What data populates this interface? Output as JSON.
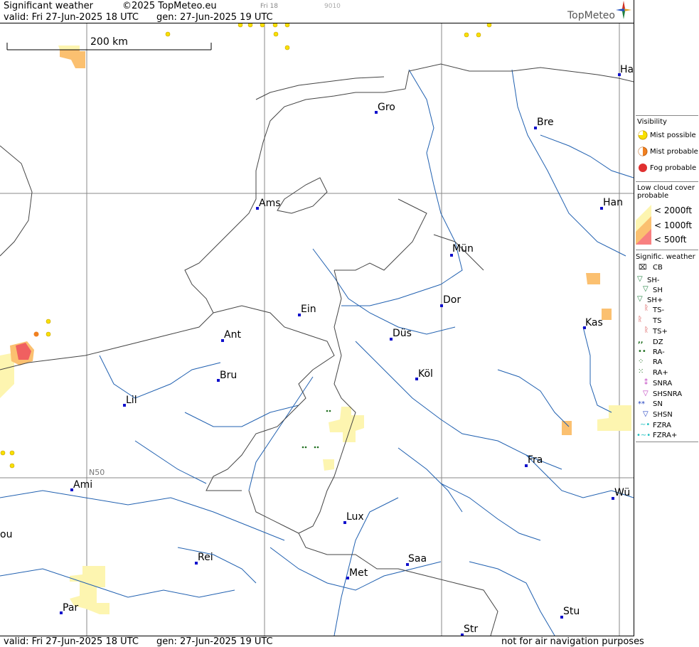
{
  "header": {
    "title": "Significant weather",
    "copyright": "©2025 TopMeteo.eu",
    "run_small": "Fri 18",
    "code_small": "9010",
    "valid": "valid:  Fri  27-Jun-2025  18 UTC",
    "gen": "gen: 27-Jun-2025 19 UTC",
    "logo": "TopMeteo"
  },
  "footer": {
    "valid": "valid:  Fri  27-Jun-2025  18 UTC",
    "gen": "gen: 27-Jun-2025 19 UTC",
    "disclaimer": "not for air navigation purposes"
  },
  "map": {
    "scale_label": "200 km",
    "lat_label": "N50",
    "cities": [
      {
        "name": "Gro"
      },
      {
        "name": "Bre"
      },
      {
        "name": "Ha"
      },
      {
        "name": "Ams"
      },
      {
        "name": "Han"
      },
      {
        "name": "Mün"
      },
      {
        "name": "Dor"
      },
      {
        "name": "Ein"
      },
      {
        "name": "Ant"
      },
      {
        "name": "Düs"
      },
      {
        "name": "Kas"
      },
      {
        "name": "Bru"
      },
      {
        "name": "Köl"
      },
      {
        "name": "Lil"
      },
      {
        "name": "Fra"
      },
      {
        "name": "Ami"
      },
      {
        "name": "Wü"
      },
      {
        "name": "ou"
      },
      {
        "name": "Lux"
      },
      {
        "name": "Rei"
      },
      {
        "name": "Saa"
      },
      {
        "name": "Met"
      },
      {
        "name": "Par"
      },
      {
        "name": "Stu"
      },
      {
        "name": "Str"
      }
    ]
  },
  "legend": {
    "visibility_title": "Visibility",
    "visibility": [
      {
        "label": "Mist possible",
        "color": "#f8e000"
      },
      {
        "label": "Mist probable",
        "color": "#f08020"
      },
      {
        "label": "Fog probable",
        "color": "#e03030"
      }
    ],
    "lowcloud_title_1": "Low cloud cover",
    "lowcloud_title_2": "probable",
    "lowcloud": [
      {
        "label": "< 2000ft",
        "color": "#fdf5b0"
      },
      {
        "label": "< 1000ft",
        "color": "#fbc070"
      },
      {
        "label": "<   500ft",
        "color": "#f88080"
      }
    ],
    "signif_title": "Signific. weather",
    "signif": [
      {
        "label": "CB"
      },
      {
        "label": "SH-"
      },
      {
        "label": "SH"
      },
      {
        "label": "SH+"
      },
      {
        "label": "TS-"
      },
      {
        "label": "TS"
      },
      {
        "label": "TS+"
      },
      {
        "label": "DZ"
      },
      {
        "label": "RA-"
      },
      {
        "label": "RA"
      },
      {
        "label": "RA+"
      },
      {
        "label": "SNRA"
      },
      {
        "label": "SHSNRA"
      },
      {
        "label": "SN"
      },
      {
        "label": "SHSN"
      },
      {
        "label": "FZRA"
      },
      {
        "label": "FZRA+"
      }
    ]
  }
}
